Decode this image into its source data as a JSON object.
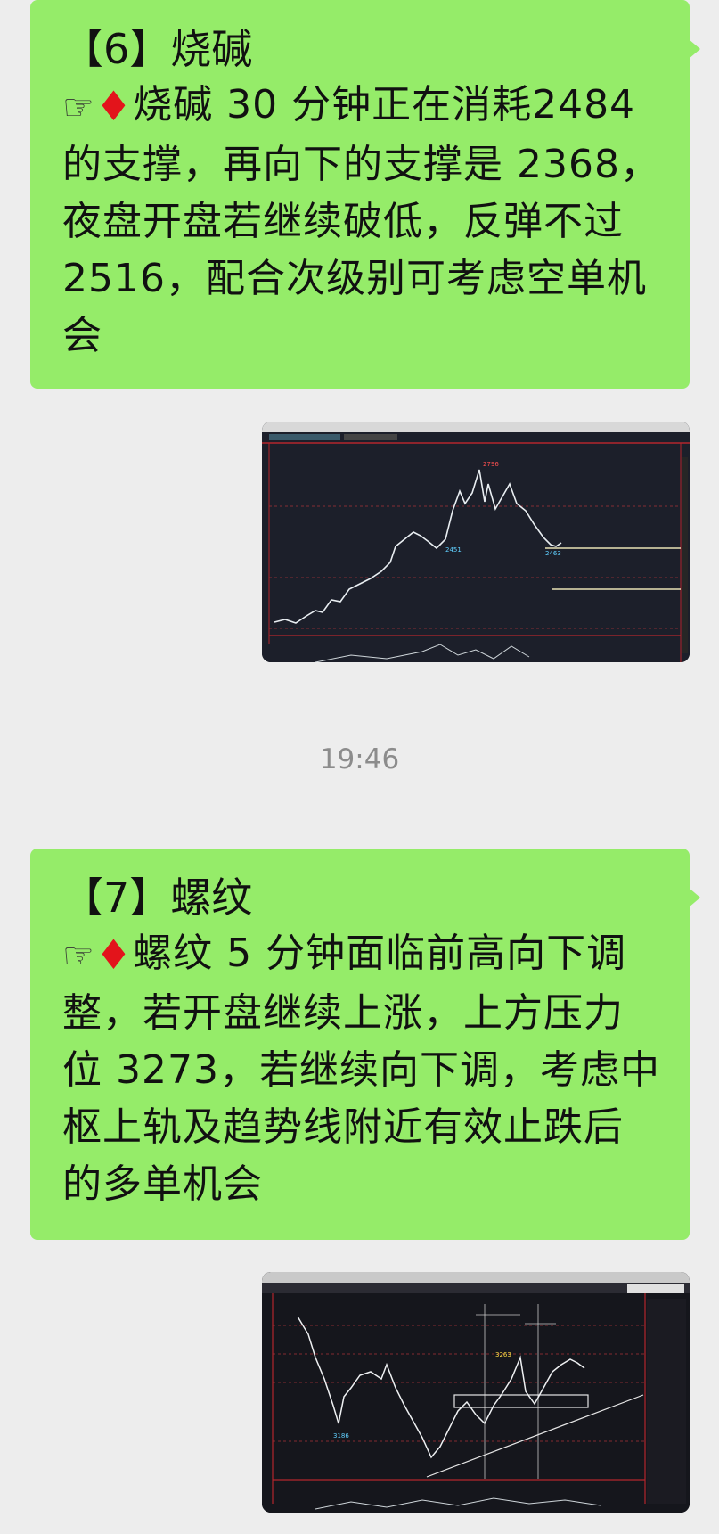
{
  "messages": [
    {
      "title": "【6】烧碱",
      "hand_icon": "pointing-hand",
      "diamond_icon": "red-diamond",
      "body_first": "烧碱 30 分钟正在消耗",
      "body_rest": "2484 的支撑，再向下的支撑是 2368，夜盘开盘若继续破低，反弹不过 2516，配合次级别可考虑空单机会"
    },
    {
      "title": "【7】螺纹",
      "hand_icon": "pointing-hand",
      "diamond_icon": "red-diamond",
      "body_first": "螺纹 5 分钟面临前高向下",
      "body_rest": "调整，若开盘继续上涨，上方压力位 3273，若继续向下调，考虑中枢上轨及趋势线附近有效止跌后的多单机会"
    }
  ],
  "timestamp": "19:46",
  "chart_images": [
    {
      "description": "caustic soda 30-minute candlestick chart screenshot",
      "theme_color": "#1c1f2a"
    },
    {
      "description": "rebar 5-minute candlestick chart screenshot",
      "theme_color": "#15161c"
    }
  ],
  "colors": {
    "bubble": "#95ec69",
    "background": "#ededed",
    "diamond": "#e3141b",
    "timestamp": "#8c8c8c"
  }
}
